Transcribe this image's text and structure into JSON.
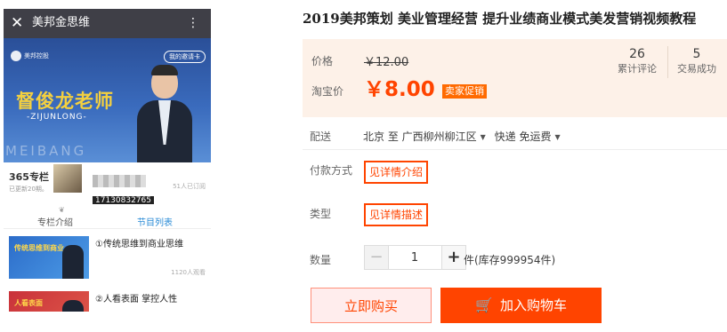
{
  "phone": {
    "close_glyph": "✕",
    "title": "美邦金思维",
    "more_glyph": "⋮",
    "banner": {
      "brand": "美邦控股",
      "invite": "我的邀请卡",
      "teacher": "督俊龙老师",
      "pinyin": "-ZIJUNLONG-",
      "watermark": "MEIBANG"
    },
    "info": {
      "column": "365专栏",
      "updated": "已更新20期。",
      "subscribers": "51人已订阅",
      "phone_tag": "17130832765"
    },
    "tabs": {
      "intro": "专栏介绍",
      "list": "节目列表"
    },
    "lessons": [
      {
        "thumb": "传统思维到商业",
        "title": "①传统思维到商业思维",
        "views": "1120人观看"
      },
      {
        "thumb": "人看表面",
        "title": "②人看表面 掌控人性",
        "views": ""
      }
    ]
  },
  "product": {
    "title": "2019美邦策划 美业管理经营 提升业绩商业模式美发营销视频教程",
    "price": {
      "label": "价格",
      "original": "￥12.00",
      "taobao_label": "淘宝价",
      "current": "￥8.00",
      "promo": "卖家促销"
    },
    "stats": [
      {
        "value": "26",
        "label": "累计评论"
      },
      {
        "value": "5",
        "label": "交易成功"
      }
    ],
    "shipping": {
      "label": "配送",
      "from": "北京 至",
      "to": "广西柳州柳江区",
      "method": "快递 免运费",
      "caret": "▼"
    },
    "payment": {
      "label": "付款方式",
      "value": "见详情介绍"
    },
    "type": {
      "label": "类型",
      "value": "见详情描述"
    },
    "quantity": {
      "label": "数量",
      "minus": "−",
      "value": "1",
      "plus": "+",
      "stock": "件(库存999954件)"
    },
    "buttons": {
      "buy_now": "立即购买",
      "add_cart": "加入购物车",
      "cart_glyph": "🛒"
    }
  }
}
